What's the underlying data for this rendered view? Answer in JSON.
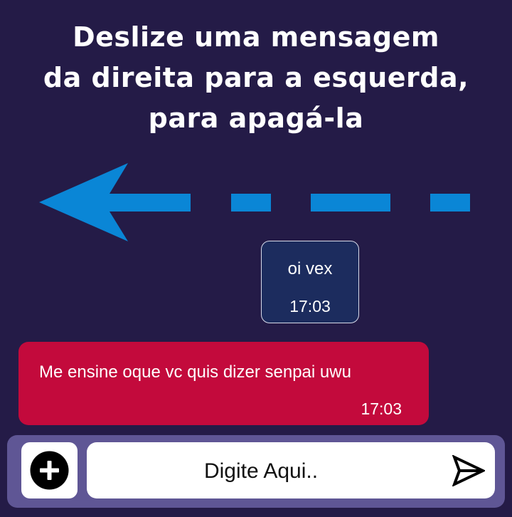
{
  "tutorial": {
    "title_lines": [
      "Deslize uma mensagem",
      "da direita para a esquerda,",
      "para apagá-la"
    ]
  },
  "messages": [
    {
      "text": "oi vex",
      "time": "17:03",
      "type": "received"
    },
    {
      "text": "Me ensine oque vc quis dizer senpai uwu",
      "time": "17:03",
      "type": "sent"
    }
  ],
  "composer": {
    "input_text": "Digite Aqui..",
    "attach_icon": "plus-circle-icon",
    "send_icon": "send-icon"
  },
  "colors": {
    "background": "#241b47",
    "arrow": "#0a86d6",
    "received_bubble": "#1c2c5e",
    "sent_bubble": "#c30a3c",
    "composer_bar": "#5f5695"
  }
}
